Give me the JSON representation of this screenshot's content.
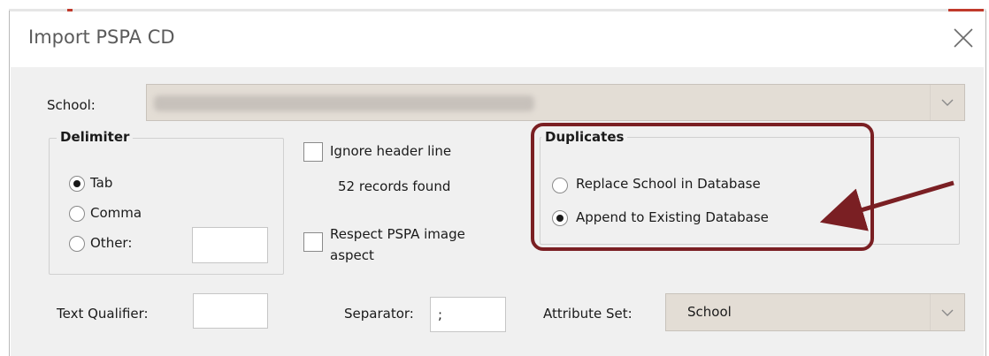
{
  "window": {
    "title": "Import PSPA CD"
  },
  "school": {
    "label": "School:"
  },
  "delimiter": {
    "title": "Delimiter",
    "options": [
      "Tab",
      "Comma",
      "Other:"
    ],
    "selected": "Tab"
  },
  "options": {
    "ignore_header": "Ignore header line",
    "records_found": "52 records found",
    "respect_aspect_line1": "Respect PSPA image",
    "respect_aspect_line2": "aspect"
  },
  "duplicates": {
    "title": "Duplicates",
    "options": [
      "Replace School in Database",
      "Append to Existing Database"
    ],
    "selected": "Append to Existing Database"
  },
  "bottom": {
    "text_qualifier_label": "Text Qualifier:",
    "separator_label": "Separator:",
    "separator_value": ";",
    "attribute_set_label": "Attribute Set:",
    "attribute_set_value": "School"
  },
  "annotation": {
    "color": "#7a1f23"
  }
}
